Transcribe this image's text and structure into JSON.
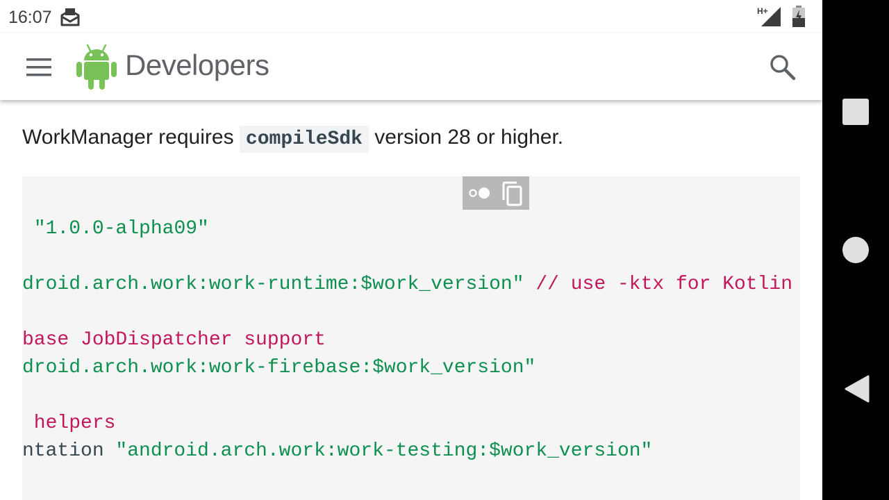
{
  "status_bar": {
    "time": "16:07",
    "icons": [
      "mail-icon",
      "signal-icon",
      "battery-icon"
    ],
    "network_label": "H+"
  },
  "app_bar": {
    "brand": "Developers",
    "icons": [
      "menu-icon",
      "android-logo-icon",
      "search-icon"
    ]
  },
  "paragraph": {
    "before": "WorkManager requires",
    "code": "compileSdk",
    "after": "version 28 or higher."
  },
  "code_block": {
    "toolbar_icons": [
      "theme-toggle-icon",
      "copy-icon"
    ],
    "lines": [
      {
        "parts": [
          {
            "text": " ",
            "kind": "pln"
          },
          {
            "text": "\"1.0.0-alpha09\"",
            "kind": "str"
          }
        ]
      },
      {
        "parts": [
          {
            "text": "droid.arch.work:work-runtime:$work_version\"",
            "kind": "str"
          },
          {
            "text": " ",
            "kind": "pln"
          },
          {
            "text": "// use -ktx for Kotlin",
            "kind": "com"
          }
        ]
      },
      {
        "parts": [
          {
            "text": "base JobDispatcher support",
            "kind": "com"
          }
        ]
      },
      {
        "parts": [
          {
            "text": "droid.arch.work:work-firebase:$work_version\"",
            "kind": "str"
          }
        ]
      },
      {
        "parts": [
          {
            "text": " helpers",
            "kind": "com"
          }
        ]
      },
      {
        "parts": [
          {
            "text": "ntation ",
            "kind": "pln"
          },
          {
            "text": "\"android.arch.work:work-testing:$work_version\"",
            "kind": "str"
          }
        ]
      }
    ]
  },
  "nav_bar": {
    "icons": [
      "recents-icon",
      "home-icon",
      "back-icon"
    ]
  },
  "colors": {
    "string": "#0d904f",
    "comment": "#c2185b",
    "plain": "#37474f",
    "code_bg": "#f5f5f5",
    "android_green": "#78c257",
    "brand_text": "#5f6368"
  }
}
